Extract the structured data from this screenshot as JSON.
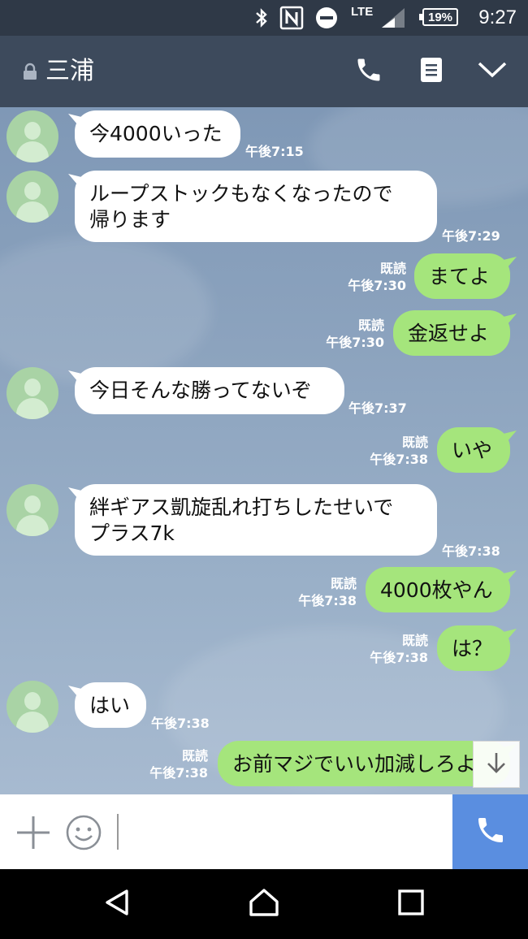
{
  "status_bar": {
    "time": "9:27",
    "battery": "19%",
    "network": "LTE",
    "icons": [
      "bluetooth-icon",
      "nfc-icon",
      "do-not-disturb-icon",
      "signal-icon",
      "battery-icon"
    ]
  },
  "header": {
    "title": "三浦",
    "icons": [
      "lock-icon",
      "phone-icon",
      "notes-icon",
      "chevron-down-icon"
    ]
  },
  "messages": [
    {
      "side": "in",
      "text": "今4000いった",
      "time": "午後7:15"
    },
    {
      "side": "in",
      "lines": [
        "ループストックもなくなったので",
        "帰ります"
      ],
      "time": "午後7:29"
    },
    {
      "side": "out",
      "text": "まてよ",
      "read": "既読",
      "time": "午後7:30"
    },
    {
      "side": "out",
      "text": "金返せよ",
      "read": "既読",
      "time": "午後7:30"
    },
    {
      "side": "in",
      "text": "今日そんな勝ってないぞ",
      "time": "午後7:37"
    },
    {
      "side": "out",
      "text": "いや",
      "read": "既読",
      "time": "午後7:38"
    },
    {
      "side": "in",
      "lines": [
        "絆ギアス凱旋乱れ打ちしたせいで",
        "プラス7k"
      ],
      "time": "午後7:38"
    },
    {
      "side": "out",
      "text": "4000枚やん",
      "read": "既読",
      "time": "午後7:38"
    },
    {
      "side": "out",
      "text": "は？",
      "read": "既読",
      "time": "午後7:38"
    },
    {
      "side": "in",
      "text": "はい",
      "time": "午後7:38"
    },
    {
      "side": "out",
      "text": "お前マジでいい加減しろよ",
      "read": "既読",
      "time": "午後7:38"
    }
  ],
  "input_bar": {
    "placeholder": "",
    "icons": [
      "plus-icon",
      "emoji-icon",
      "call-icon"
    ]
  },
  "nav_bar": {
    "icons": [
      "back-icon",
      "home-icon",
      "recents-icon"
    ]
  },
  "colors": {
    "status_bar": "#2f3947",
    "header": "#3d4a5c",
    "outgoing_bubble": "#a5e57c",
    "incoming_bubble": "#ffffff",
    "call_button": "#5a8ee0"
  }
}
